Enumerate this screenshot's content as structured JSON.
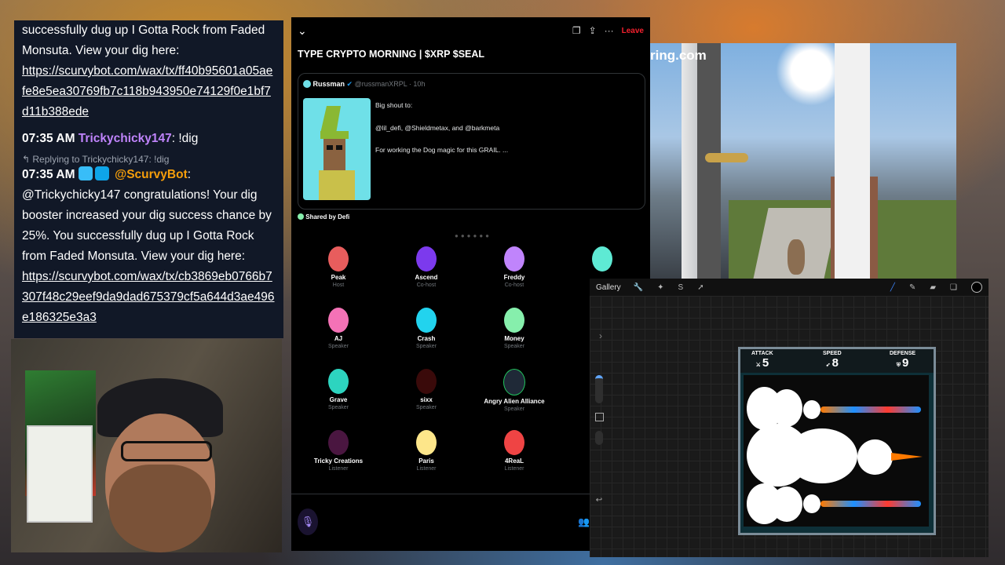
{
  "chat": {
    "line1": "successfully dug up I Gotta Rock from Faded Monsuta. View your dig here:",
    "link1": "https://scurvybot.com/wax/tx/ff40b95601a05aefe8e5ea30769fb7c118b943950e74129f0e1bf7d11b388ede",
    "msg2_time": "07:35 AM",
    "msg2_user": "Trickychicky147",
    "msg2_text": ": !dig",
    "reply_label": "Replying to Trickychicky147: !dig",
    "msg3_time": "07:35 AM",
    "msg3_user": "@ScurvyBot",
    "msg3_text": "@Trickychicky147 congratulations! Your dig booster increased your dig success chance by 25%. You successfully dug up I Gotta Rock from Faded Monsuta. View your dig here:",
    "link2": "https://scurvybot.com/wax/tx/cb3869eb0766b7307f48c29eef9da9dad675379cf5a644d3ae496e186325e3a3"
  },
  "spaces": {
    "leave": "Leave",
    "title": "TYPE CRYPTO MORNING | $XRP $SEAL",
    "tweet": {
      "name": "Russman",
      "handle": "@russmanXRPL · 10h",
      "line1": "Big shout to:",
      "line2": "@lil_defi, @Shieldmetax, and @barkmeta",
      "line3": "For working the Dog magic for this GRAIL. ..."
    },
    "shared_by": "Shared by Defi",
    "speakers": [
      {
        "name": "Peak",
        "role": "Host",
        "color": "#e85d5d"
      },
      {
        "name": "Ascend",
        "role": "Co-host",
        "color": "#7c3aed"
      },
      {
        "name": "Freddy",
        "role": "Co-host",
        "color": "#c084fc"
      },
      {
        "name": "",
        "role": "",
        "color": "#5eead4"
      },
      {
        "name": "AJ",
        "role": "Speaker",
        "color": "#f472b6"
      },
      {
        "name": "Crash",
        "role": "Speaker",
        "color": "#22d3ee"
      },
      {
        "name": "Money",
        "role": "Speaker",
        "color": "#86efac"
      },
      {
        "name": "Grave",
        "role": "Speaker",
        "color": "#2dd4bf"
      },
      {
        "name": "sixx",
        "role": "Speaker",
        "color": "#3a0a0a"
      },
      {
        "name": "Angry Alien Alliance",
        "role": "Speaker",
        "color": "#1f2937"
      },
      {
        "name": "Tricky Creations",
        "role": "Listener",
        "color": "#4a1640"
      },
      {
        "name": "Paris",
        "role": "Listener",
        "color": "#fde68a"
      },
      {
        "name": "4ReaL",
        "role": "Listener",
        "color": "#ef4444"
      }
    ]
  },
  "doorbell": {
    "logo": "ring.com"
  },
  "procreate": {
    "gallery": "Gallery",
    "card": {
      "attack_label": "ATTACK",
      "attack": "5",
      "speed_label": "SPEED",
      "speed": "8",
      "defense_label": "DEFENSE",
      "defense": "9"
    }
  }
}
